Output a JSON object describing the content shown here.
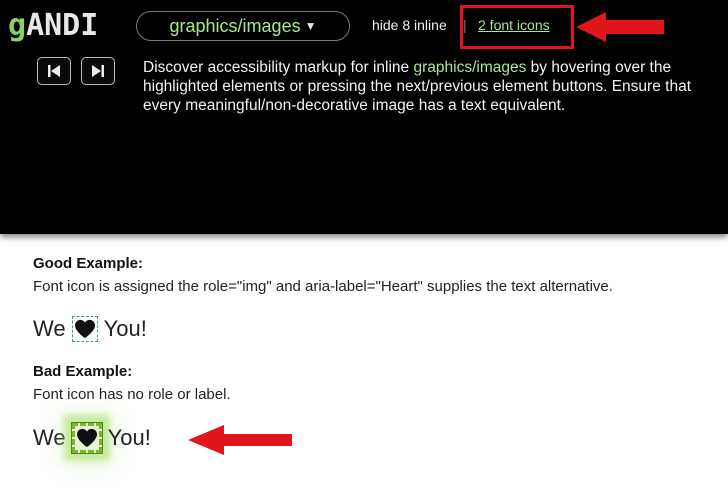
{
  "toolbar": {
    "logo_g": "g",
    "logo_rest": "ANDI",
    "mode": "graphics/images",
    "hide_inline": "hide 8 inline",
    "separator": "|",
    "font_icons_link": "2 font icons",
    "summary_part1": "Discover accessibility markup for inline ",
    "summary_accent": "graphics/images",
    "summary_part2": " by hovering over the highlighted elements or pressing the next/previous element buttons. Ensure that every meaningful/non-decorative image has a text equivalent.",
    "prev_icon": "skip-previous-icon",
    "next_icon": "skip-next-icon"
  },
  "content": {
    "good_heading": "Good Example:",
    "good_text": "Font icon is assigned the role=\"img\" and aria-label=\"Heart\" supplies the text alternative.",
    "bad_heading": "Bad Example:",
    "bad_text": "Font icon has no role or label.",
    "we_word": "We",
    "you_word": "You!",
    "heart_icon": "heart-icon"
  },
  "colors": {
    "panel_bg": "#000000",
    "accent_green": "#a6e88f",
    "annotation_red": "#e0161c",
    "highlight_green": "#7ab52a"
  }
}
